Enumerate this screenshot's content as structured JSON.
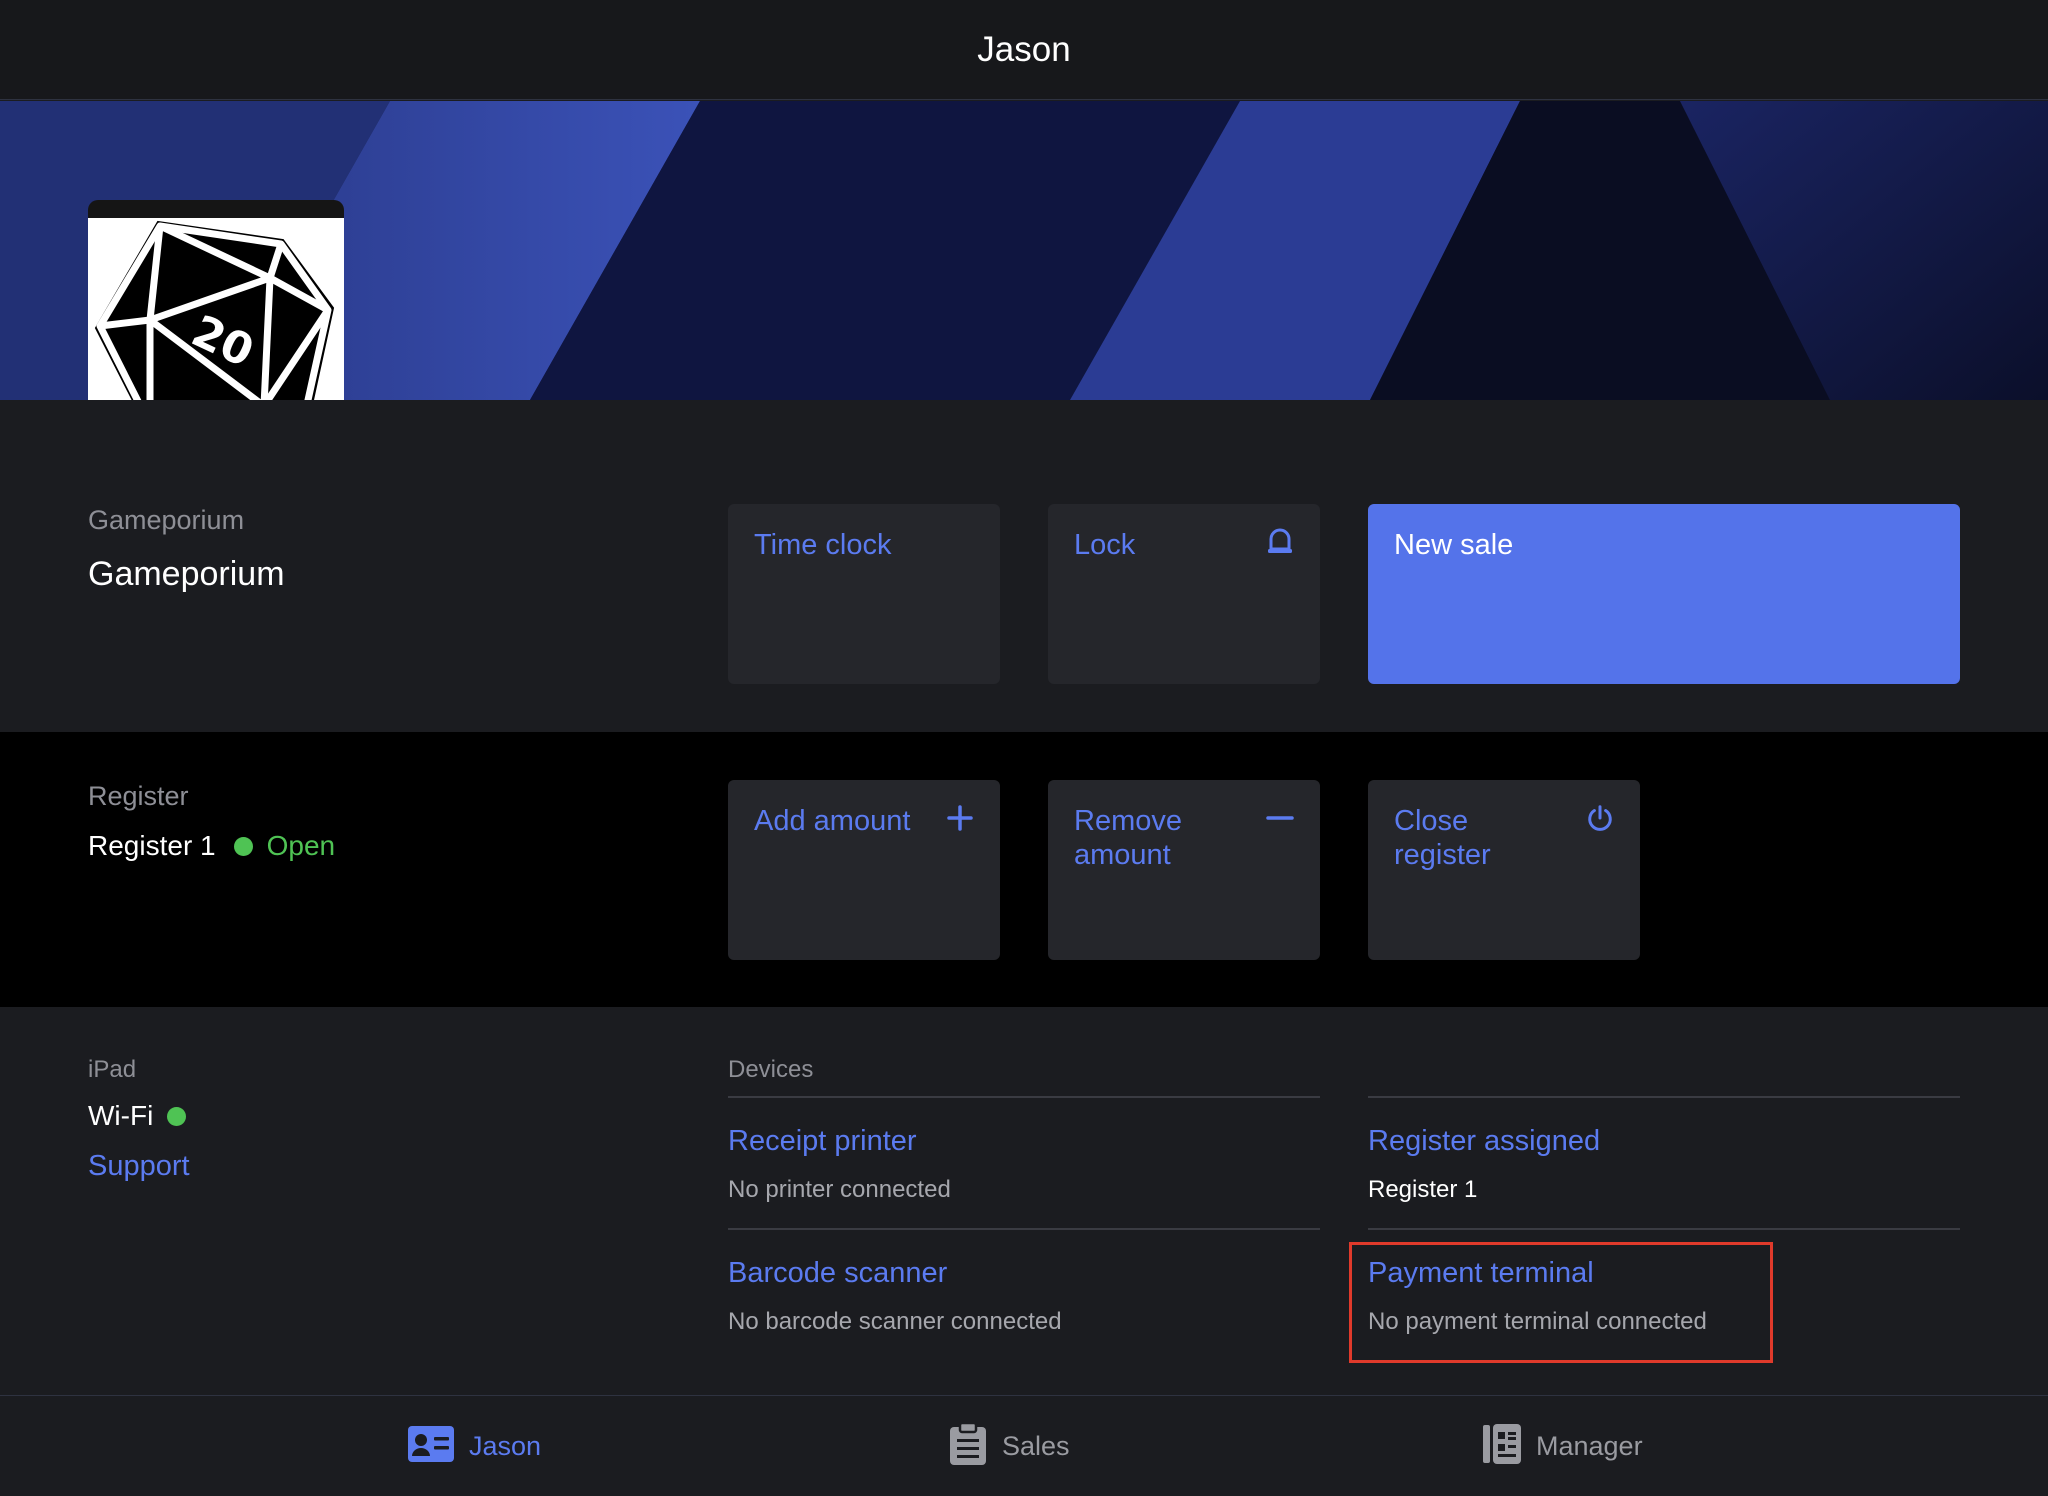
{
  "header": {
    "title": "Jason"
  },
  "colors": {
    "accent": "#5473ea",
    "link": "#5b7bf0",
    "status_open": "#4fc354",
    "highlight": "#e03a2b"
  },
  "store": {
    "avatar_icon": "d20-dice-icon",
    "avatar_number": "20",
    "label": "Gameporium",
    "name": "Gameporium"
  },
  "actions": {
    "time_clock": "Time clock",
    "lock": "Lock",
    "new_sale": "New sale"
  },
  "register": {
    "label": "Register",
    "name": "Register 1",
    "status": "Open",
    "add_amount": "Add amount",
    "remove_amount": "Remove amount",
    "close_register": "Close register"
  },
  "ipad": {
    "label": "iPad",
    "wifi": "Wi-Fi",
    "support": "Support"
  },
  "devices": {
    "label": "Devices",
    "receipt_printer": {
      "title": "Receipt printer",
      "status": "No printer connected"
    },
    "register_assigned": {
      "title": "Register assigned",
      "status": "Register 1"
    },
    "barcode_scanner": {
      "title": "Barcode scanner",
      "status": "No barcode scanner connected"
    },
    "payment_terminal": {
      "title": "Payment terminal",
      "status": "No payment terminal connected"
    }
  },
  "tabs": [
    {
      "label": "Jason",
      "icon": "contact-card-icon",
      "active": true
    },
    {
      "label": "Sales",
      "icon": "clipboard-icon",
      "active": false
    },
    {
      "label": "Manager",
      "icon": "manager-book-icon",
      "active": false
    }
  ]
}
